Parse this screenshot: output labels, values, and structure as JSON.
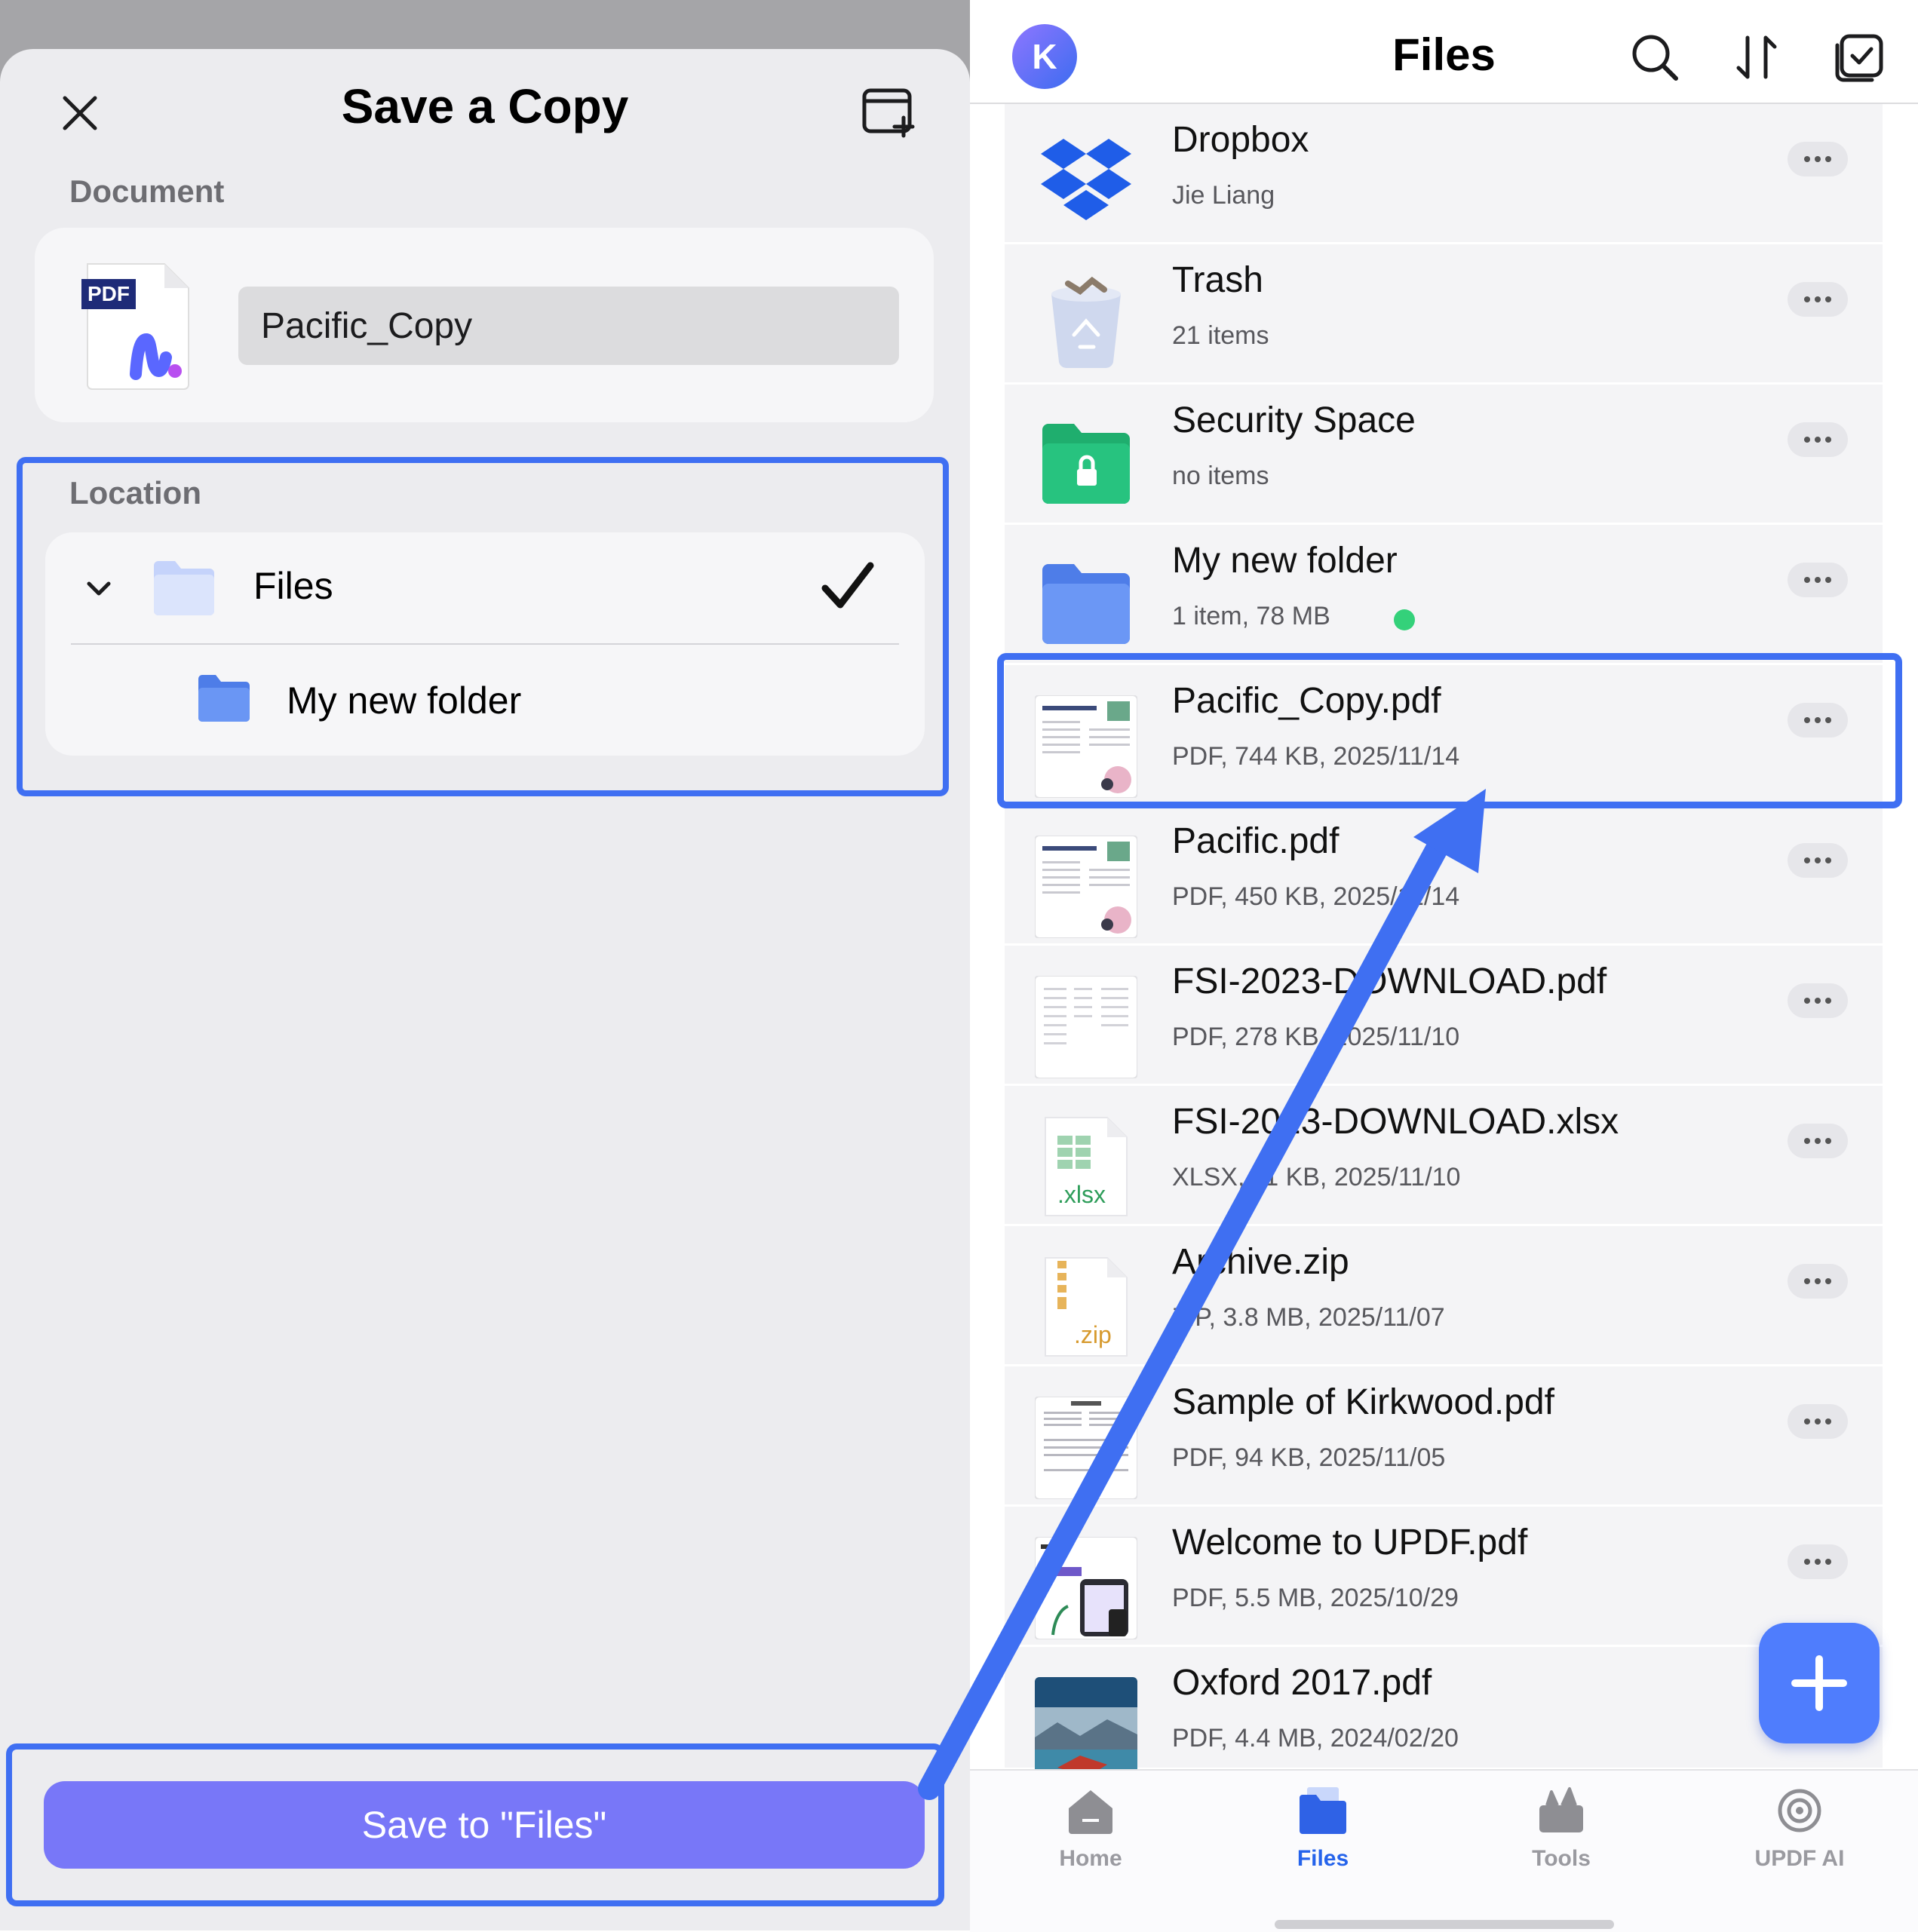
{
  "dialog": {
    "title": "Save a Copy",
    "document_label": "Document",
    "document_name": "Pacific_Copy",
    "document_badge": "PDF",
    "location_label": "Location",
    "locations": [
      {
        "label": "Files",
        "selected": true
      },
      {
        "label": "My new folder",
        "selected": false
      }
    ],
    "save_button": "Save to \"Files\""
  },
  "files_panel": {
    "avatar_letter": "K",
    "title": "Files",
    "items": [
      {
        "name": "Dropbox",
        "meta": "Jie Liang",
        "icon": "dropbox-icon"
      },
      {
        "name": "Trash",
        "meta": "21 items",
        "icon": "trash-icon"
      },
      {
        "name": "Security Space",
        "meta": "no items",
        "icon": "lock-folder-icon"
      },
      {
        "name": "My new folder",
        "meta": "1 item, 78 MB",
        "icon": "folder-icon"
      },
      {
        "name": "Pacific_Copy.pdf",
        "meta": "PDF, 744 KB, 2025/11/14",
        "icon": "pdf-thumbnail"
      },
      {
        "name": "Pacific.pdf",
        "meta": "PDF, 450 KB, 2025/11/14",
        "icon": "pdf-thumbnail"
      },
      {
        "name": "FSI-2023-DOWNLOAD.pdf",
        "meta": "PDF, 278 KB, 2025/11/10",
        "icon": "pdf-thumbnail"
      },
      {
        "name": "FSI-2023-DOWNLOAD.xlsx",
        "meta": "XLSX, 11 KB, 2025/11/10",
        "icon": "xlsx-icon"
      },
      {
        "name": "Archive.zip",
        "meta": "ZIP, 3.8 MB, 2025/11/07",
        "icon": "zip-icon"
      },
      {
        "name": "Sample of Kirkwood.pdf",
        "meta": "PDF, 94 KB, 2025/11/05",
        "icon": "pdf-thumbnail"
      },
      {
        "name": "Welcome to UPDF.pdf",
        "meta": "PDF, 5.5 MB, 2025/10/29",
        "icon": "pdf-thumbnail"
      },
      {
        "name": "Oxford 2017.pdf",
        "meta": "PDF, 4.4 MB, 2024/02/20",
        "icon": "pdf-thumbnail"
      }
    ],
    "xlsx_label": ".xlsx",
    "zip_label": ".zip",
    "tabs": [
      {
        "label": "Home",
        "active": false
      },
      {
        "label": "Files",
        "active": true
      },
      {
        "label": "Tools",
        "active": false
      },
      {
        "label": "UPDF AI",
        "active": false
      }
    ]
  },
  "colors": {
    "accent": "#3f6ff2",
    "save_button": "#7877f8",
    "fab": "#4f7dfd",
    "synced_dot": "#34d17a"
  }
}
